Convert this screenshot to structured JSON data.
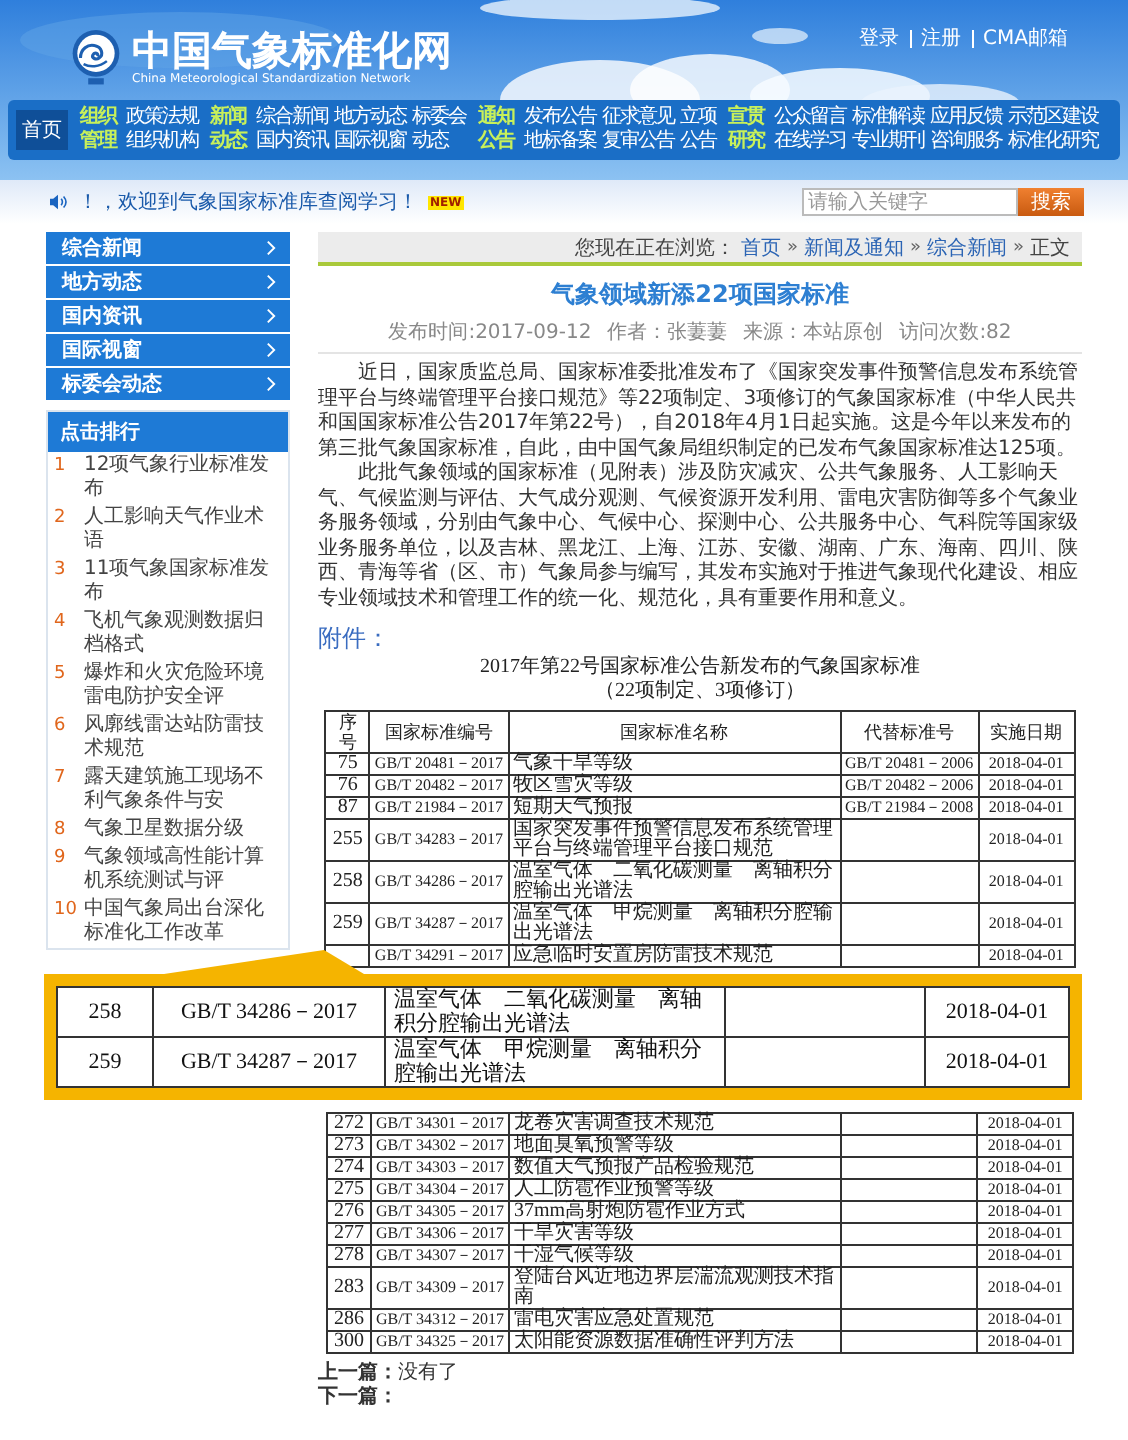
{
  "header": {
    "site_title": "中国气象标准化网",
    "site_subtitle": "China Meteorological Standardization Network",
    "top_links": [
      "登录",
      "注册",
      "CMA邮箱"
    ]
  },
  "nav": {
    "home": {
      "label": "首页",
      "selected": true
    },
    "groups": [
      {
        "label": "组织管理",
        "links": [
          [
            "政策法规"
          ],
          [
            "组织机构"
          ]
        ]
      },
      {
        "label": "新闻动态",
        "links": [
          [
            "综合新闻",
            "地方动态",
            "标委会"
          ],
          [
            "国内资讯",
            "国际视窗",
            "动态"
          ]
        ]
      },
      {
        "label": "通知公告",
        "links": [
          [
            "发布公告",
            "征求意见",
            "立项"
          ],
          [
            "地标备案",
            "复审公告",
            "公告"
          ]
        ]
      },
      {
        "label": "宣贯研究",
        "links": [
          [
            "公众留言",
            "标准解读",
            "应用反馈",
            "示范区建设"
          ],
          [
            "在线学习",
            "专业期刊",
            "咨询服务",
            "标准化研究"
          ]
        ]
      }
    ]
  },
  "notice": {
    "text": "！，欢迎到气象国家标准库查阅学习！",
    "badge": "NEW"
  },
  "search": {
    "placeholder": "请输入关键字",
    "button": "搜索"
  },
  "sidebar": {
    "categories": [
      "综合新闻",
      "地方动态",
      "国内资讯",
      "国际视窗",
      "标委会动态"
    ],
    "ranking_title": "点击排行",
    "ranking": [
      {
        "no": "1",
        "title": "12项气象行业标准发布"
      },
      {
        "no": "2",
        "title": "人工影响天气作业术语"
      },
      {
        "no": "3",
        "title": "11项气象国家标准发布"
      },
      {
        "no": "4",
        "title": "飞机气象观测数据归档格式"
      },
      {
        "no": "5",
        "title": "爆炸和火灾危险环境雷电防护安全评"
      },
      {
        "no": "6",
        "title": "风廓线雷达站防雷技术规范"
      },
      {
        "no": "7",
        "title": "露天建筑施工现场不利气象条件与安"
      },
      {
        "no": "8",
        "title": "气象卫星数据分级"
      },
      {
        "no": "9",
        "title": "气象领域高性能计算机系统测试与评"
      },
      {
        "no": "10",
        "title": "中国气象局出台深化标准化工作改革"
      }
    ]
  },
  "breadcrumb": {
    "prefix": "您现在正在浏览：",
    "links": [
      "首页",
      "新闻及通知",
      "综合新闻"
    ],
    "current": "正文",
    "separator": "»"
  },
  "article": {
    "title": "气象领域新添22项国家标准",
    "meta": [
      "发布时间:2017-09-12",
      "作者：张萋萋",
      "来源：本站原创",
      "访问次数:82"
    ],
    "paragraphs": [
      "近日，国家质监总局、国家标准委批准发布了《国家突发事件预警信息发布系统管理平台与终端管理平台接口规范》等22项制定、3项修订的气象国家标准（中华人民共和国国家标准公告2017年第22号），自2018年4月1日起实施。这是今年以来发布的第三批气象国家标准，自此，由中国气象局组织制定的已发布气象国家标准达125项。",
      "此批气象领域的国家标准（见附表）涉及防灾减灾、公共气象服务、人工影响天气、气候监测与评估、大气成分观测、气候资源开发利用、雷电灾害防御等多个气象业务服务领域，分别由气象中心、气候中心、探测中心、公共服务中心、气科院等国家级业务服务单位，以及吉林、黑龙江、上海、江苏、安徽、湖南、广东、海南、四川、陕西、青海等省（区、市）气象局参与编写，其发布实施对于推进气象现代化建设、相应专业领域技术和管理工作的统一化、规范化，具有重要作用和意义。"
    ]
  },
  "attachment": {
    "label": "附件：",
    "title_lines": [
      "2017年第22号国家标准公告新发布的气象国家标准",
      "（22项制定、3项修订）"
    ],
    "columns": [
      "序号",
      "国家标准编号",
      "国家标准名称",
      "代替标准号",
      "实施日期"
    ],
    "rows_above": [
      {
        "no": "75",
        "code": "GB/T 20481－2017",
        "name": "气象干旱等级",
        "replaces": "GB/T 20481－2006",
        "date": "2018-04-01"
      },
      {
        "no": "76",
        "code": "GB/T 20482－2017",
        "name": "牧区雪灾等级",
        "replaces": "GB/T 20482－2006",
        "date": "2018-04-01"
      },
      {
        "no": "87",
        "code": "GB/T 21984－2017",
        "name": "短期天气预报",
        "replaces": "GB/T 21984－2008",
        "date": "2018-04-01"
      },
      {
        "no": "255",
        "code": "GB/T 34283－2017",
        "name": "国家突发事件预警信息发布系统管理平台与终端管理平台接口规范",
        "date": "2018-04-01"
      },
      {
        "no": "258",
        "code": "GB/T 34286－2017",
        "name": "温室气体　二氧化碳测量　离轴积分腔输出光谱法",
        "date": "2018-04-01"
      },
      {
        "no": "259",
        "code": "GB/T 34287－2017",
        "name": "温室气体　甲烷测量　离轴积分腔输出光谱法",
        "date": "2018-04-01"
      },
      {
        "code": "GB/T 34291－2017",
        "name": "应急临时安置房防雷技术规范",
        "date": "2018-04-01"
      }
    ],
    "callout_rows": [
      {
        "no": "258",
        "code": "GB/T 34286－2017",
        "name": "温室气体　二氧化碳测量　离轴积分腔输出光谱法",
        "date": "2018-04-01"
      },
      {
        "no": "259",
        "code": "GB/T 34287－2017",
        "name": "温室气体　甲烷测量　离轴积分腔输出光谱法",
        "date": "2018-04-01"
      }
    ],
    "rows_below": [
      {
        "no": "272",
        "code": "GB/T 34301－2017",
        "name": "龙卷灾害调查技术规范",
        "date": "2018-04-01"
      },
      {
        "no": "273",
        "code": "GB/T 34302－2017",
        "name": "地面臭氧预警等级",
        "date": "2018-04-01"
      },
      {
        "no": "274",
        "code": "GB/T 34303－2017",
        "name": "数值天气预报产品检验规范",
        "date": "2018-04-01"
      },
      {
        "no": "275",
        "code": "GB/T 34304－2017",
        "name": "人工防雹作业预警等级",
        "date": "2018-04-01"
      },
      {
        "no": "276",
        "code": "GB/T 34305－2017",
        "name": "37mm高射炮防雹作业方式",
        "date": "2018-04-01"
      },
      {
        "no": "277",
        "code": "GB/T 34306－2017",
        "name": "干旱灾害等级",
        "date": "2018-04-01"
      },
      {
        "no": "278",
        "code": "GB/T 34307－2017",
        "name": "干湿气候等级",
        "date": "2018-04-01"
      },
      {
        "no": "283",
        "code": "GB/T 34309－2017",
        "name": "登陆台风近地边界层湍流观测技术指南",
        "date": "2018-04-01"
      },
      {
        "no": "286",
        "code": "GB/T 34312－2017",
        "name": "雷电灾害应急处置规范",
        "date": "2018-04-01"
      },
      {
        "no": "300",
        "code": "GB/T 34325－2017",
        "name": "太阳能资源数据准确性评判方法",
        "date": "2018-04-01"
      }
    ]
  },
  "pager": [
    "**上一篇：**没有了",
    "**下一篇：**"
  ]
}
